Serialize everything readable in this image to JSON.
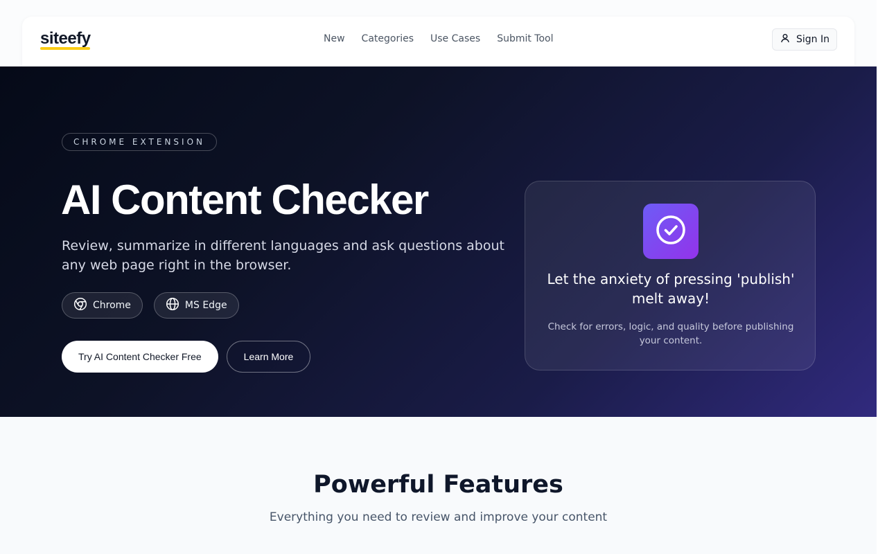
{
  "header": {
    "logo": "siteefy",
    "nav": [
      {
        "label": "New"
      },
      {
        "label": "Categories"
      },
      {
        "label": "Use Cases"
      },
      {
        "label": "Submit Tool"
      }
    ],
    "signin_label": "Sign In"
  },
  "hero": {
    "badge": "CHROME EXTENSION",
    "title": "AI Content Checker",
    "description": "Review, summarize in different languages and ask questions about any web page right in the browser.",
    "browsers": [
      {
        "label": "Chrome",
        "icon": "chrome-icon"
      },
      {
        "label": "MS Edge",
        "icon": "globe-icon"
      }
    ],
    "primary_cta": "Try AI Content Checker Free",
    "secondary_cta": "Learn More",
    "card": {
      "icon": "check-circle-icon",
      "title": "Let the anxiety of pressing 'publish' melt away!",
      "subtitle": "Check for errors, logic, and quality before publishing your content."
    }
  },
  "features": {
    "title": "Powerful Features",
    "subtitle": "Everything you need to review and improve your content"
  },
  "colors": {
    "hero_dark": "#050a18",
    "hero_accent": "#312a7e",
    "icon_gradient_start": "#6d5cf6",
    "icon_gradient_end": "#9333ea",
    "logo_underline": "#facc15"
  }
}
